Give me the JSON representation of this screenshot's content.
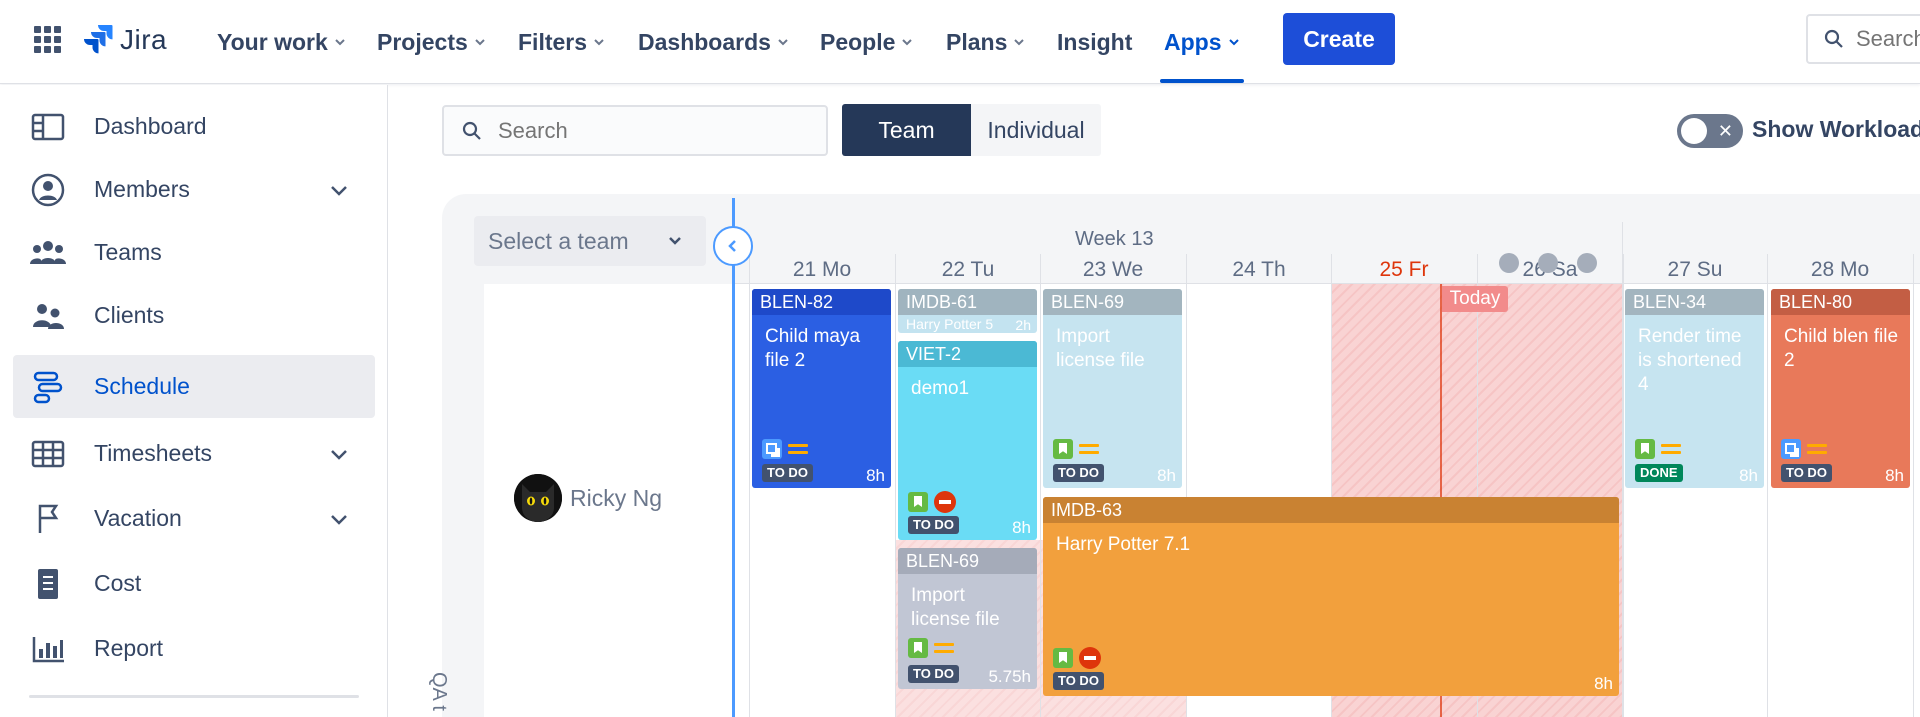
{
  "nav": {
    "logo_text": "Jira",
    "items": [
      {
        "label": "Your work"
      },
      {
        "label": "Projects"
      },
      {
        "label": "Filters"
      },
      {
        "label": "Dashboards"
      },
      {
        "label": "People"
      },
      {
        "label": "Plans"
      },
      {
        "label": "Insight"
      },
      {
        "label": "Apps"
      }
    ],
    "active_item": "Apps",
    "create_label": "Create",
    "search_placeholder": "Search",
    "accent_color": "#0052cc"
  },
  "sidebar": {
    "items": [
      {
        "label": "Dashboard",
        "icon": "dashboard-icon"
      },
      {
        "label": "Members",
        "icon": "member-icon",
        "expandable": true
      },
      {
        "label": "Teams",
        "icon": "teams-icon"
      },
      {
        "label": "Clients",
        "icon": "clients-icon"
      },
      {
        "label": "Schedule",
        "icon": "schedule-icon",
        "active": true
      },
      {
        "label": "Timesheets",
        "icon": "timesheet-icon",
        "expandable": true
      },
      {
        "label": "Vacation",
        "icon": "flag-icon",
        "expandable": true
      },
      {
        "label": "Cost",
        "icon": "receipt-icon"
      },
      {
        "label": "Report",
        "icon": "bar-chart-icon"
      }
    ]
  },
  "toolbar": {
    "search_placeholder": "Search",
    "view_team": "Team",
    "view_individual": "Individual",
    "active_view": "Team",
    "show_workload_label": "Show Workload",
    "show_workload_on": false
  },
  "schedule": {
    "team_select_placeholder": "Select a team",
    "group_label": "QA t",
    "person": {
      "name": "Ricky Ng",
      "avatar": "black-cat-avatar"
    },
    "week_label": "Week 13",
    "days": [
      "21 Mo",
      "22 Tu",
      "23 We",
      "24 Th",
      "25 Fr",
      "26 Sa",
      "27 Su",
      "28 Mo"
    ],
    "today": "25 Fr",
    "today_label": "Today",
    "tasks": [
      {
        "key": "BLEN-82",
        "title": "Child maya file 2",
        "status": "TO DO",
        "hours": "8h"
      },
      {
        "key": "IMDB-61",
        "subtitle": "Harry Potter 5",
        "hours": "2h"
      },
      {
        "key": "VIET-2",
        "title": "demo1",
        "status": "TO DO",
        "hours": "8h"
      },
      {
        "key": "BLEN-69",
        "title": "Import license file",
        "status": "TO DO",
        "hours": "5.75h"
      },
      {
        "key": "BLEN-69",
        "title": "Import license file",
        "status": "TO DO",
        "hours": "8h"
      },
      {
        "key": "IMDB-63",
        "title": "Harry Potter 7.1",
        "status": "TO DO",
        "hours": "8h"
      },
      {
        "key": "BLEN-34",
        "title": "Render time is shortened 4",
        "status": "DONE",
        "hours": "8h"
      },
      {
        "key": "BLEN-80",
        "title": "Child blen file 2",
        "status": "TO DO",
        "hours": "8h"
      }
    ]
  }
}
